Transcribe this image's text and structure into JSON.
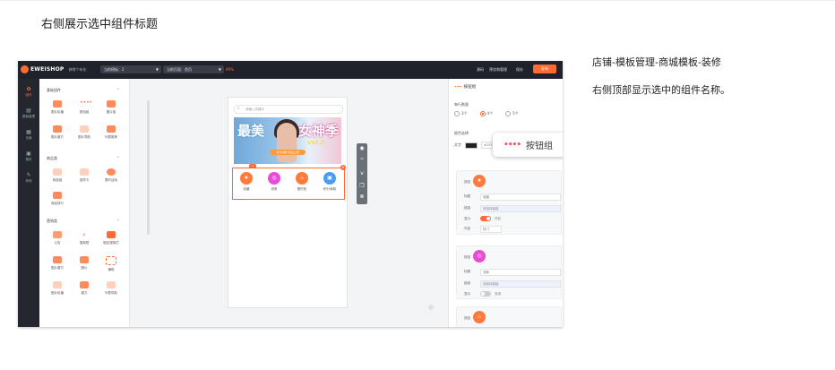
{
  "caption": "右侧展示选中组件标题",
  "notes": {
    "path": "店铺-模板管理-商城模板-装修",
    "desc": "右侧顶部显示选中的组件名称。"
  },
  "topbar": {
    "logo": "EWEISHOP",
    "logo_sub": "做哪个有化",
    "template_select": "当前模板：",
    "template_value": "2",
    "page_select": "当前页面：",
    "page_value": "首页",
    "page_tag": "99%",
    "links": [
      "源码",
      "预览和管理",
      "保存"
    ],
    "publish": "发布"
  },
  "iconnav": [
    {
      "label": "组件",
      "icon": "✿",
      "active": true
    },
    {
      "label": "模板管理",
      "icon": "▤",
      "active": false
    },
    {
      "label": "页面",
      "icon": "▦",
      "active": false
    },
    {
      "label": "素材",
      "icon": "▣",
      "active": false
    },
    {
      "label": "其他",
      "icon": "✎",
      "active": false
    }
  ],
  "library": {
    "groups": [
      {
        "title": "基础组件",
        "items": [
          "图片轮播",
          "按钮组",
          "图片组",
          "图片魔方",
          "图片导航",
          "列表推荐"
        ]
      },
      {
        "title": "商品类",
        "items": [
          "商品组",
          "选项卡",
          "限时活动",
          "商品排行"
        ]
      },
      {
        "title": "营销类",
        "items": [
          "公告",
          "搜索框",
          "固定搜索栏",
          "图片魔方",
          "图片",
          "辅助",
          "图片轮播",
          "魔方",
          "列表导航"
        ]
      }
    ]
  },
  "phone": {
    "search_placeholder": "请输入关键字",
    "banner_left": "最美",
    "banner_right": "女神季",
    "banner_vol": "vol.2",
    "banner_tag": "春日焕新 新品上线",
    "buttons": [
      {
        "label": "收藏",
        "color": "#ff7a3c"
      },
      {
        "label": "领券",
        "color": "#e94ad6"
      },
      {
        "label": "限时抢",
        "color": "#ff7a3c"
      },
      {
        "label": "积分商城",
        "color": "#4a9cf0"
      }
    ],
    "badge": "1"
  },
  "props": {
    "title": "按钮组",
    "per_row_label": "每行数量",
    "per_row_options": [
      "3个",
      "4个",
      "5个"
    ],
    "per_row_selected": 1,
    "color_label": "颜色选择",
    "text_label": "文字",
    "text_color": "#333333",
    "cards": [
      {
        "icon_label": "按钮",
        "title_label": "标题",
        "title_value": "收藏",
        "link_label": "链接",
        "link_value": "请选择链接",
        "show_label": "显示",
        "show_value": "开启",
        "content_label": "内容",
        "content_value": "热门",
        "on": true,
        "color": "#ff7a3c"
      },
      {
        "icon_label": "按钮",
        "title_label": "标题",
        "title_value": "领券",
        "link_label": "链接",
        "link_value": "请选择链接",
        "show_label": "显示",
        "show_value": "关闭",
        "on": false,
        "color": "#e94ad6"
      },
      {
        "icon_label": "按钮",
        "color": "#ff7a3c"
      }
    ]
  },
  "callout": {
    "label": "按钮组"
  },
  "colors": {
    "accent": "#ff6b35",
    "dark": "#1f2229"
  }
}
